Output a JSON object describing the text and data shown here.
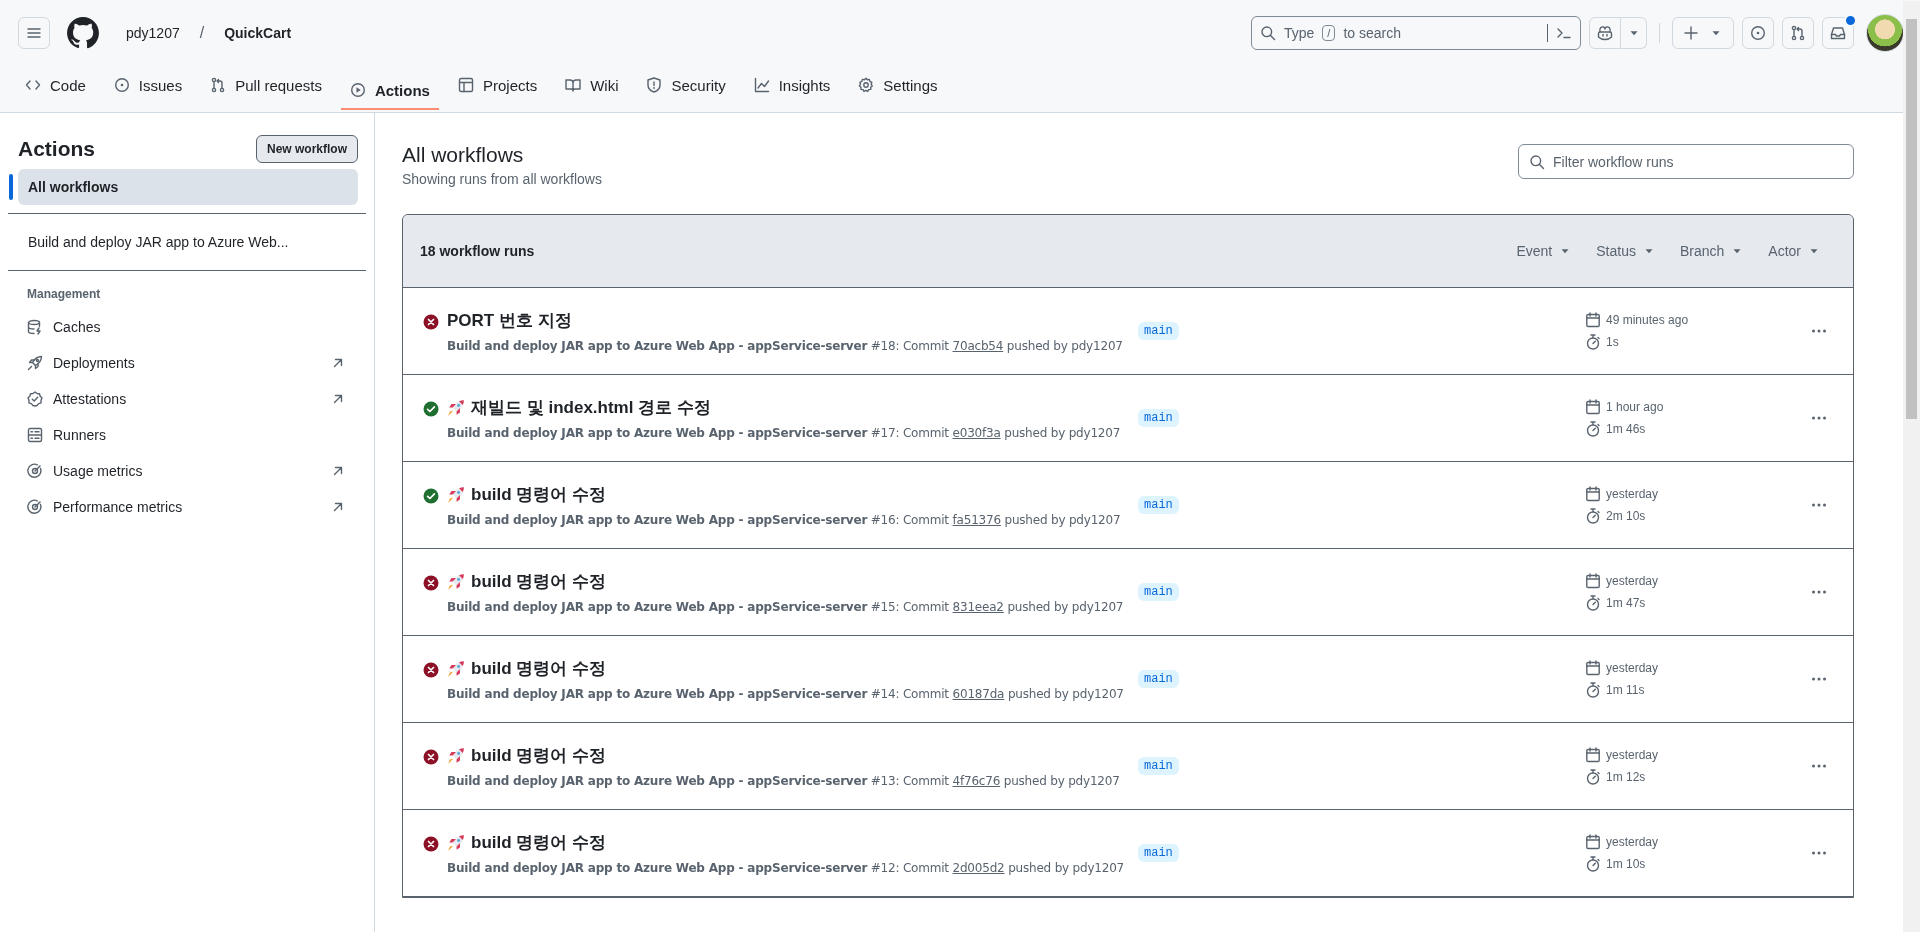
{
  "header": {
    "owner": "pdy1207",
    "separator": "/",
    "repo": "QuickCart",
    "search": {
      "before": "Type",
      "key": "/",
      "after": "to search"
    },
    "inbox_unread": true
  },
  "nav_tabs": [
    {
      "label": "Code",
      "selected": false
    },
    {
      "label": "Issues",
      "selected": false
    },
    {
      "label": "Pull requests",
      "selected": false
    },
    {
      "label": "Actions",
      "selected": true
    },
    {
      "label": "Projects",
      "selected": false
    },
    {
      "label": "Wiki",
      "selected": false
    },
    {
      "label": "Security",
      "selected": false
    },
    {
      "label": "Insights",
      "selected": false
    },
    {
      "label": "Settings",
      "selected": false
    }
  ],
  "sidebar": {
    "title": "Actions",
    "new_button": "New workflow",
    "workflows": [
      {
        "label": "All workflows",
        "selected": true
      },
      {
        "label": "Build and deploy JAR app to Azure Web...",
        "selected": false
      }
    ],
    "management_heading": "Management",
    "management_items": [
      {
        "label": "Caches",
        "external": false
      },
      {
        "label": "Deployments",
        "external": true
      },
      {
        "label": "Attestations",
        "external": true
      },
      {
        "label": "Runners",
        "external": false
      },
      {
        "label": "Usage metrics",
        "external": true
      },
      {
        "label": "Performance metrics",
        "external": true
      }
    ]
  },
  "main": {
    "title": "All workflows",
    "subtitle": "Showing runs from all workflows",
    "filter": {
      "placeholder": "Filter workflow runs"
    },
    "runs_count": "18 workflow runs",
    "filters": [
      "Event",
      "Status",
      "Branch",
      "Actor"
    ],
    "runs": [
      {
        "succeeded": false,
        "rocket": false,
        "title": "PORT 번호 지정",
        "description": "**Build and deploy JAR app to Azure Web App - appService-server** #18: Commit",
        "commit": "70acb54",
        "pushed_by": "pushed by pdy1207",
        "branch": "main",
        "when": "49 minutes ago",
        "duration": "1s"
      },
      {
        "succeeded": true,
        "rocket": true,
        "title": "재빌드 및 index.html 경로 수정",
        "description": "**Build and deploy JAR app to Azure Web App - appService-server** #17: Commit",
        "commit": "e030f3a",
        "pushed_by": "pushed by pdy1207",
        "branch": "main",
        "when": "1 hour ago",
        "duration": "1m 46s"
      },
      {
        "succeeded": true,
        "rocket": true,
        "title": "build 명령어 수정",
        "description": "**Build and deploy JAR app to Azure Web App - appService-server** #16: Commit",
        "commit": "fa51376",
        "pushed_by": "pushed by pdy1207",
        "branch": "main",
        "when": "yesterday",
        "duration": "2m 10s"
      },
      {
        "succeeded": false,
        "rocket": true,
        "title": "build 명령어 수정",
        "description": "**Build and deploy JAR app to Azure Web App - appService-server** #15: Commit",
        "commit": "831eea2",
        "pushed_by": "pushed by pdy1207",
        "branch": "main",
        "when": "yesterday",
        "duration": "1m 47s"
      },
      {
        "succeeded": false,
        "rocket": true,
        "title": "build 명령어 수정",
        "description": "**Build and deploy JAR app to Azure Web App - appService-server** #14: Commit",
        "commit": "60187da",
        "pushed_by": "pushed by pdy1207",
        "branch": "main",
        "when": "yesterday",
        "duration": "1m 11s"
      },
      {
        "succeeded": false,
        "rocket": true,
        "title": "build 명령어 수정",
        "description": "**Build and deploy JAR app to Azure Web App - appService-server** #13: Commit",
        "commit": "4f76c76",
        "pushed_by": "pushed by pdy1207",
        "branch": "main",
        "when": "yesterday",
        "duration": "1m 12s"
      },
      {
        "succeeded": false,
        "rocket": true,
        "title": "build 명령어 수정",
        "description": "**Build and deploy JAR app to Azure Web App - appService-server** #12: Commit",
        "commit": "2d005d2",
        "pushed_by": "pushed by pdy1207",
        "branch": "main",
        "when": "yesterday",
        "duration": "1m 10s"
      }
    ]
  }
}
